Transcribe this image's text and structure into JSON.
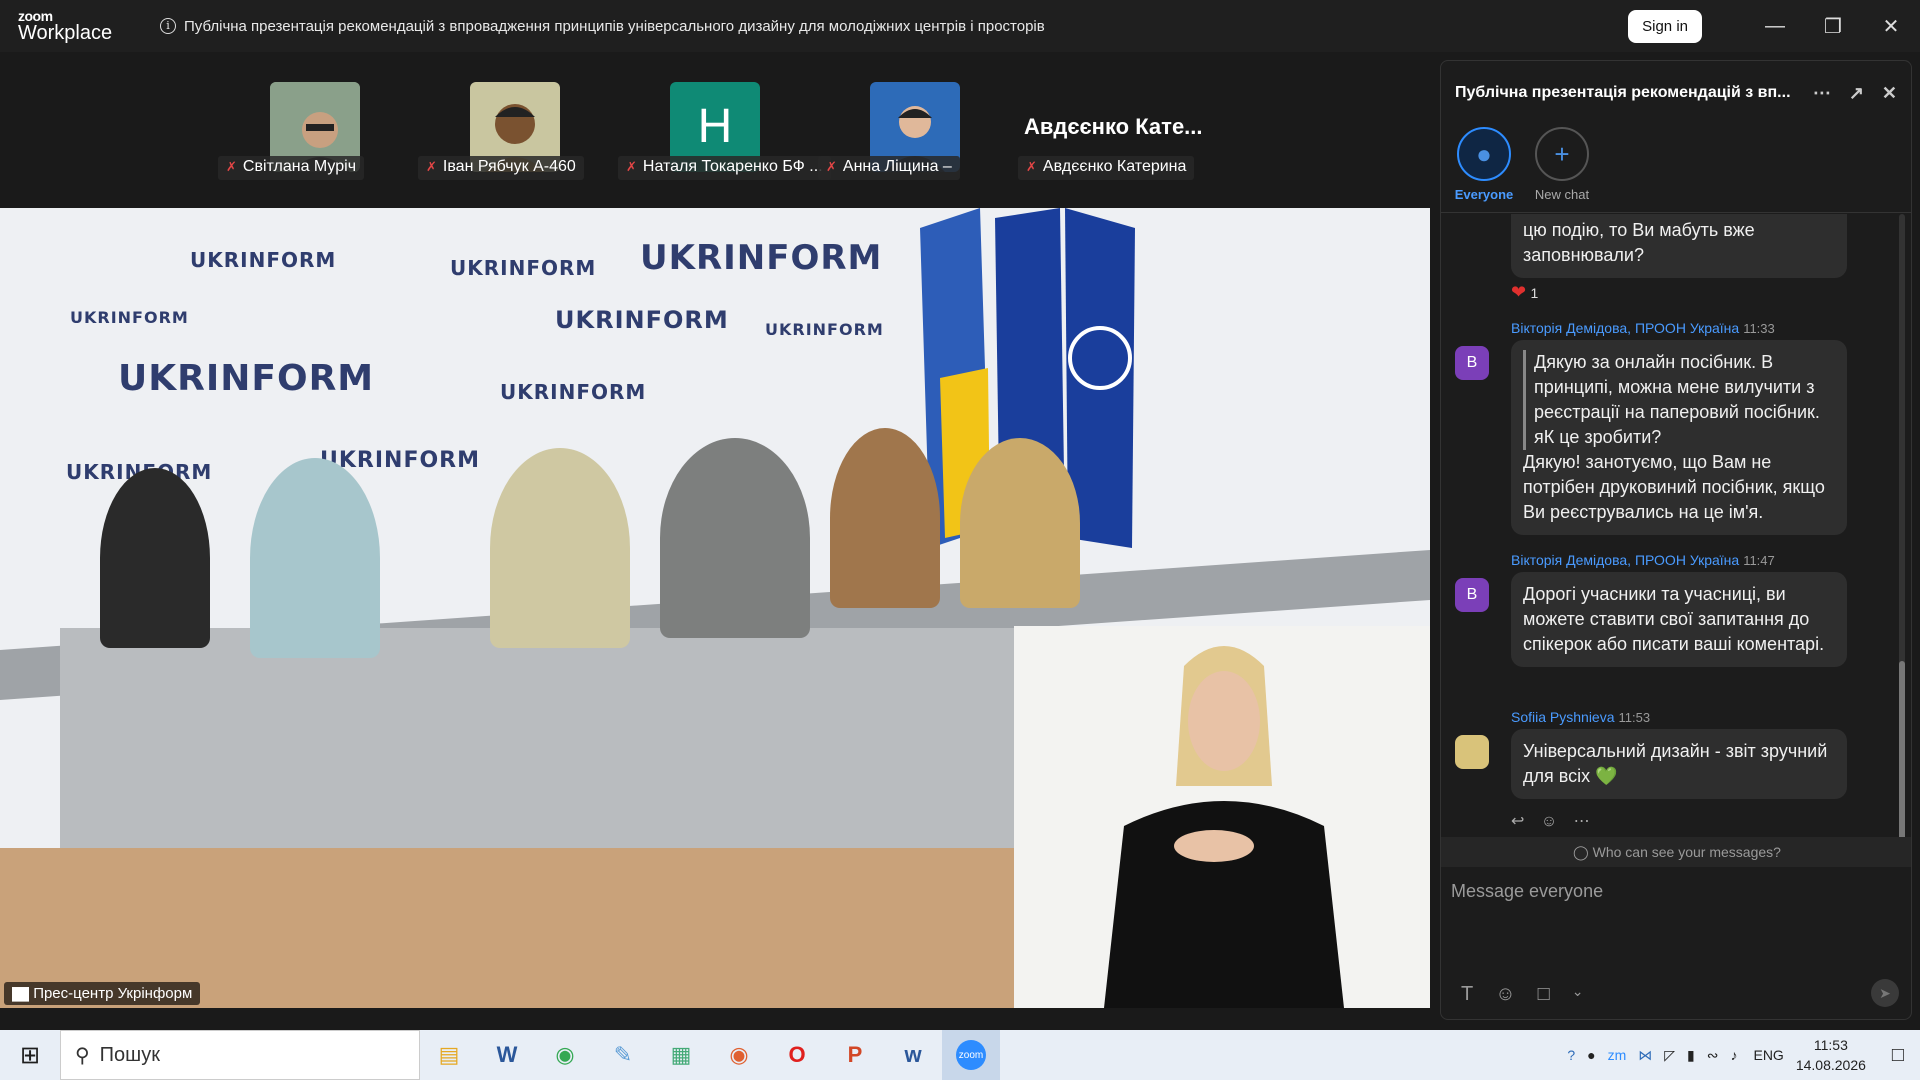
{
  "app": {
    "brand_small": "zoom",
    "brand_large": "Workplace"
  },
  "titlebar": {
    "meeting_title": "Публічна презентація рекомендацій з впровадження принципів універсального дизайну для молодіжних центрів і просторів",
    "sign_in": "Sign in"
  },
  "participants": [
    {
      "name": "Світлана Муріч",
      "muted": true,
      "tile_color": "#6c7d8a"
    },
    {
      "name": "Іван Рябчук A-460",
      "muted": true,
      "tile_color": "#a89c5f"
    },
    {
      "name": "Наталя Токаренко БФ ...",
      "muted": true,
      "initial": "H",
      "tile_color": "#0f8a75"
    },
    {
      "name": "Анна Ліщина –",
      "muted": true,
      "tile_color": "#2d6bb8"
    },
    {
      "name": "Авдєєнко Катерина",
      "muted": true,
      "header_name": "Авдєєнко Кате..."
    }
  ],
  "video": {
    "label": "Прес-центр Укрінформ",
    "backdrop_brand": "UKRINFORM"
  },
  "chat": {
    "title": "Публічна презентація рекомендацій з вп...",
    "tabs": [
      {
        "label": "Everyone",
        "icon": "people-icon"
      },
      {
        "label": "New chat",
        "icon": "plus-icon"
      }
    ],
    "partial_message": "цю подію, то Ви мабуть вже заповнювали?",
    "reaction": {
      "emoji": "❤️",
      "count": "1"
    },
    "messages": [
      {
        "sender": "Вікторія Демідова, ПРООН Україна",
        "time": "11:33",
        "avatar": "В",
        "quote": "Дякую за онлайн посібник. В принципі, можна мене вилучити з реєстрації на паперовий посібник. яК це зробити?",
        "text": "Дякую! занотуємо, що Вам не потрібен друковиний посібник, якщо Ви реєструвались на це ім'я."
      },
      {
        "sender": "Вікторія Демідова, ПРООН Україна",
        "time": "11:47",
        "avatar": "В",
        "text": "Дорогі учасники та учасниці, ви можете ставити свої запитання до спікерок або писати ваші коментарі."
      },
      {
        "sender": "Sofiia Pyshnieva",
        "time": "11:53",
        "text": " Універсальний дизайн - звіт зручний для всіх 💚"
      }
    ],
    "who_can_see": "Who can see your messages?",
    "composer_placeholder": "Message everyone"
  },
  "taskbar": {
    "search_placeholder": "Пошук",
    "lang": "ENG",
    "time": "11:53",
    "date": "14.08.2026"
  }
}
